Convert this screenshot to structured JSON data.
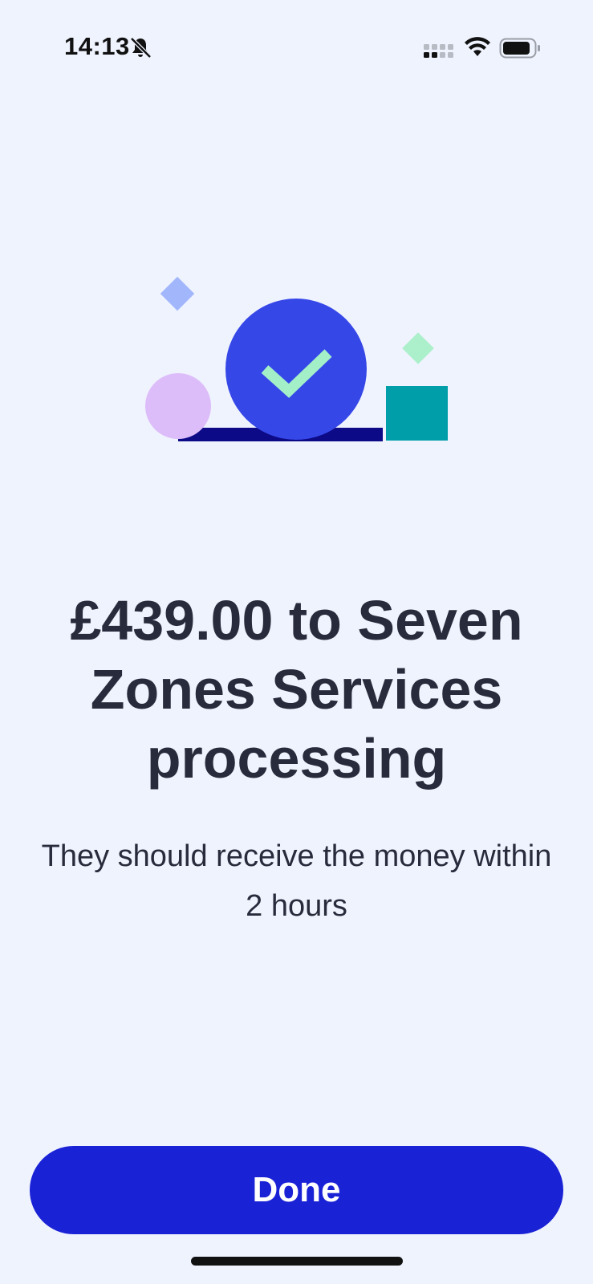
{
  "status_bar": {
    "time": "14:13",
    "icons": [
      "bell-slash-icon",
      "cellular-signal-icon",
      "wifi-icon",
      "battery-icon"
    ]
  },
  "illustration": {
    "icon": "success-check-icon",
    "colors": {
      "circle": "#3647E8",
      "check": "#A3F0C8",
      "pink_circle": "#DDBDF9",
      "teal_square": "#009EA8",
      "blue_diamond": "#A2B6FB",
      "green_diamond": "#ABEFCB",
      "base_bar": "#0C0A86"
    }
  },
  "confirmation": {
    "headline": "£439.00 to Seven Zones Services processing",
    "subtext": "They should receive the money within 2 hours"
  },
  "actions": {
    "done_label": "Done"
  },
  "colors": {
    "background": "#EFF3FE",
    "accent": "#1A22D6",
    "text": "#272B3B"
  }
}
